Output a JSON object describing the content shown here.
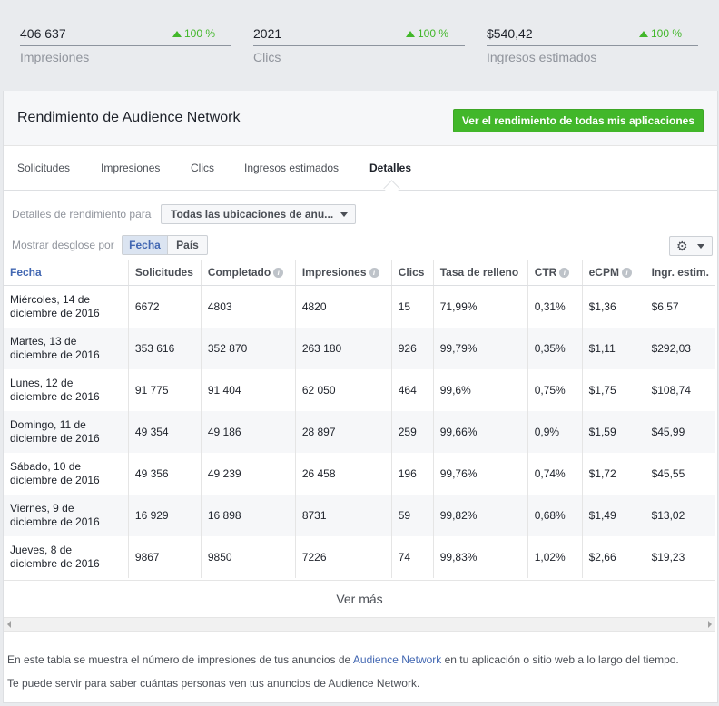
{
  "summary": [
    {
      "value": "406 637",
      "change": "100 %",
      "label": "Impresiones"
    },
    {
      "value": "2021",
      "change": "100 %",
      "label": "Clics"
    },
    {
      "value": "$540,42",
      "change": "100 %",
      "label": "Ingresos estimados"
    }
  ],
  "card": {
    "title": "Rendimiento de Audience Network",
    "cta": "Ver el rendimiento de todas mis aplicaciones"
  },
  "tabs": [
    "Solicitudes",
    "Impresiones",
    "Clics",
    "Ingresos estimados",
    "Detalles"
  ],
  "active_tab": "Detalles",
  "filters": {
    "details_label": "Detalles de rendimiento para",
    "placement_value": "Todas las ubicaciones de anu...",
    "breakdown_label": "Mostrar desglose por",
    "breakdown_options": [
      "Fecha",
      "País"
    ],
    "breakdown_selected": "Fecha"
  },
  "table": {
    "columns": [
      "Fecha",
      "Solicitudes",
      "Completado",
      "Impresiones",
      "Clics",
      "Tasa de relleno",
      "CTR",
      "eCPM",
      "Ingr. estim."
    ],
    "rows": [
      [
        "Miércoles, 14 de diciembre de 2016",
        "6672",
        "4803",
        "4820",
        "15",
        "71,99%",
        "0,31%",
        "$1,36",
        "$6,57"
      ],
      [
        "Martes, 13 de diciembre de 2016",
        "353 616",
        "352 870",
        "263 180",
        "926",
        "99,79%",
        "0,35%",
        "$1,11",
        "$292,03"
      ],
      [
        "Lunes, 12 de diciembre de 2016",
        "91 775",
        "91 404",
        "62 050",
        "464",
        "99,6%",
        "0,75%",
        "$1,75",
        "$108,74"
      ],
      [
        "Domingo, 11 de diciembre de 2016",
        "49 354",
        "49 186",
        "28 897",
        "259",
        "99,66%",
        "0,9%",
        "$1,59",
        "$45,99"
      ],
      [
        "Sábado, 10 de diciembre de 2016",
        "49 356",
        "49 239",
        "26 458",
        "196",
        "99,76%",
        "0,74%",
        "$1,72",
        "$45,55"
      ],
      [
        "Viernes, 9 de diciembre de 2016",
        "16 929",
        "16 898",
        "8731",
        "59",
        "99,82%",
        "0,68%",
        "$1,49",
        "$13,02"
      ],
      [
        "Jueves, 8 de diciembre de 2016",
        "9867",
        "9850",
        "7226",
        "74",
        "99,83%",
        "1,02%",
        "$2,66",
        "$19,23"
      ]
    ]
  },
  "see_more": "Ver más",
  "footer": {
    "line1_before": "En este tabla se muestra el número de impresiones de tus anuncios de ",
    "line1_link": "Audience Network",
    "line1_after": " en tu aplicación o sitio web a lo largo del tiempo.",
    "line2": "Te puede servir para saber cuántas personas ven tus anuncios de Audience Network."
  },
  "colors": {
    "accent": "#4267b2",
    "positive": "#42b72a"
  },
  "icons": {
    "gear": "gear-icon",
    "info": "info-icon"
  }
}
